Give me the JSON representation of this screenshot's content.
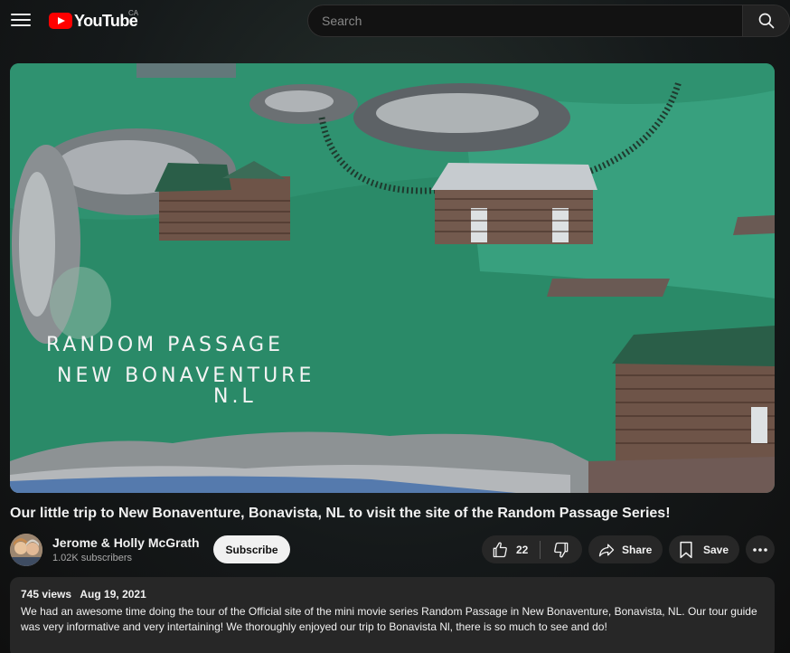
{
  "header": {
    "logo_text": "YouTube",
    "country_code": "CA",
    "search_placeholder": "Search",
    "icons": [
      "menu-icon",
      "search-icon"
    ]
  },
  "video": {
    "thumbnail_text": [
      "RANDOM PASSAGE",
      "NEW BONAVENTURE",
      "N.L"
    ],
    "title": "Our little trip to New Bonaventure, Bonavista, NL to visit the site of the Random Passage Series!"
  },
  "channel": {
    "name": "Jerome & Holly McGrath",
    "subscribers": "1.02K subscribers",
    "subscribe_label": "Subscribe"
  },
  "actions": {
    "like_count": "22",
    "share_label": "Share",
    "save_label": "Save",
    "icons": [
      "thumbs-up-icon",
      "thumbs-down-icon",
      "share-icon",
      "bookmark-icon",
      "more-icon"
    ]
  },
  "description": {
    "views": "745 views",
    "date": "Aug 19, 2021",
    "text": "We had an awesome time doing the tour of the Official site of the mini movie series Random Passage in New Bonaventure, Bonavista, NL. Our tour guide was very informative and very intertaining!  We thoroughly enjoyed our trip to Bonavista Nl, there is so much to see and do!"
  },
  "colors": {
    "background": "#0f0f0f",
    "brand_red": "#ff0000",
    "pill": "#272727",
    "painting_green": "#2f8f6e"
  }
}
